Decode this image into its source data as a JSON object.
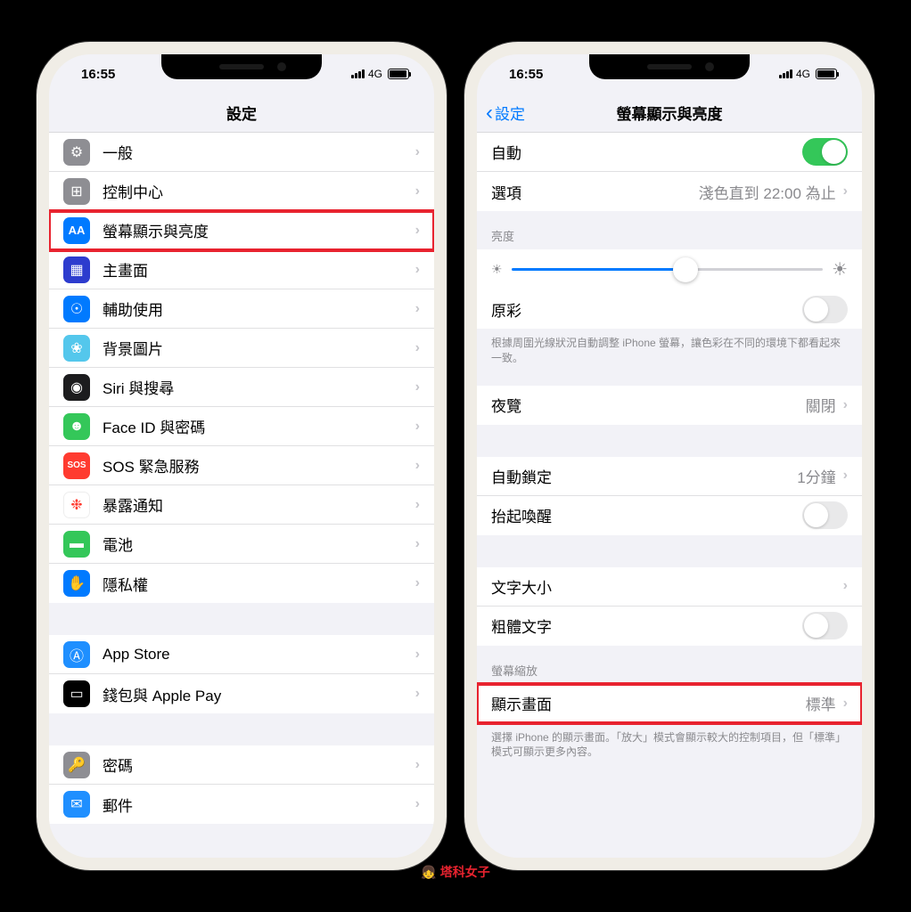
{
  "status": {
    "time": "16:55",
    "network": "4G"
  },
  "left": {
    "title": "設定",
    "items": [
      {
        "icon": "ic-general",
        "glyph": "⚙",
        "label": "一般",
        "name": "general"
      },
      {
        "icon": "ic-control",
        "glyph": "⊞",
        "label": "控制中心",
        "name": "control-center"
      },
      {
        "icon": "ic-display",
        "glyph": "AA",
        "label": "螢幕顯示與亮度",
        "name": "display-brightness",
        "hl": true
      },
      {
        "icon": "ic-home",
        "glyph": "▦",
        "label": "主畫面",
        "name": "home-screen"
      },
      {
        "icon": "ic-access",
        "glyph": "☉",
        "label": "輔助使用",
        "name": "accessibility"
      },
      {
        "icon": "ic-wallpaper",
        "glyph": "❀",
        "label": "背景圖片",
        "name": "wallpaper"
      },
      {
        "icon": "ic-siri",
        "glyph": "◉",
        "label": "Siri 與搜尋",
        "name": "siri-search"
      },
      {
        "icon": "ic-faceid",
        "glyph": "☻",
        "label": "Face ID 與密碼",
        "name": "faceid-passcode"
      },
      {
        "icon": "ic-sos",
        "glyph": "SOS",
        "label": "SOS 緊急服務",
        "name": "sos"
      },
      {
        "icon": "ic-exposure",
        "glyph": "❉",
        "label": "暴露通知",
        "name": "exposure"
      },
      {
        "icon": "ic-battery",
        "glyph": "▬",
        "label": "電池",
        "name": "battery"
      },
      {
        "icon": "ic-privacy",
        "glyph": "✋",
        "label": "隱私權",
        "name": "privacy"
      }
    ],
    "items2": [
      {
        "icon": "ic-appstore",
        "glyph": "Ⓐ",
        "label": "App Store",
        "name": "app-store"
      },
      {
        "icon": "ic-wallet",
        "glyph": "▭",
        "label": "錢包與 Apple Pay",
        "name": "wallet"
      }
    ],
    "items3": [
      {
        "icon": "ic-password",
        "glyph": "🔑",
        "label": "密碼",
        "name": "passwords"
      },
      {
        "icon": "ic-mail",
        "glyph": "✉",
        "label": "郵件",
        "name": "mail"
      }
    ]
  },
  "right": {
    "back": "設定",
    "title": "螢幕顯示與亮度",
    "auto_label": "自動",
    "options_label": "選項",
    "options_value": "淺色直到 22:00 為止",
    "brightness_header": "亮度",
    "truetone_label": "原彩",
    "truetone_footer": "根據周圍光線狀況自動調整 iPhone 螢幕，讓色彩在不同的環境下都看起來一致。",
    "nightshift_label": "夜覽",
    "nightshift_value": "關閉",
    "autolock_label": "自動鎖定",
    "autolock_value": "1分鐘",
    "raise_label": "抬起喚醒",
    "textsize_label": "文字大小",
    "bold_label": "粗體文字",
    "zoom_header": "螢幕縮放",
    "view_label": "顯示畫面",
    "view_value": "標準",
    "view_footer": "選擇 iPhone 的顯示畫面。「放大」模式會顯示較大的控制項目，但「標準」模式可顯示更多內容。"
  },
  "watermark": "塔科女子"
}
